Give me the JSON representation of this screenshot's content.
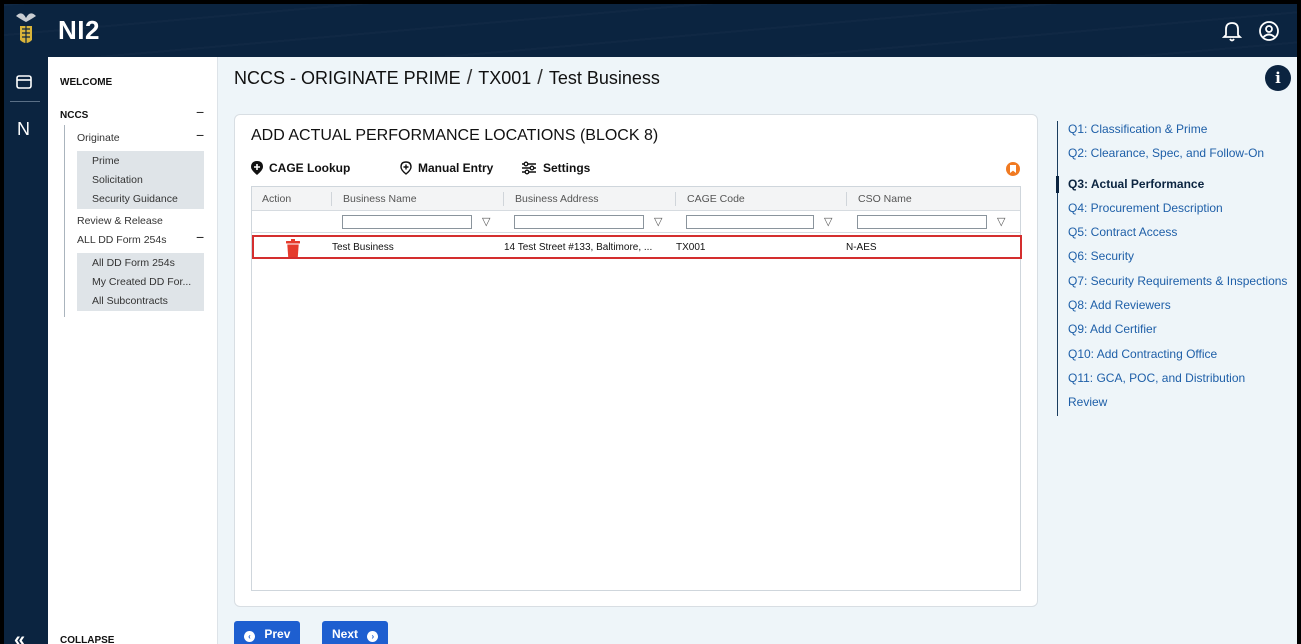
{
  "app": {
    "brand": "NI2"
  },
  "rail": {
    "letter": "N",
    "collapse_glyph": "«"
  },
  "sidenav": {
    "welcome": "WELCOME",
    "nccs": "NCCS",
    "originate": "Originate",
    "originate_items": [
      "Prime",
      "Solicitation",
      "Security Guidance"
    ],
    "review_release": "Review & Release",
    "all_dd": "ALL DD Form 254s",
    "all_dd_items": [
      "All DD Form 254s",
      "My Created DD For...",
      "All Subcontracts"
    ],
    "collapse": "COLLAPSE",
    "minus": "−"
  },
  "breadcrumb": {
    "part1": "NCCS - ORIGINATE PRIME",
    "part2": "TX001",
    "part3": "Test Business",
    "separator": "/"
  },
  "info_glyph": "i",
  "card": {
    "title": "ADD ACTUAL PERFORMANCE LOCATIONS (BLOCK 8)",
    "tools": {
      "cage_lookup": "CAGE Lookup",
      "manual_entry": "Manual Entry",
      "settings": "Settings"
    }
  },
  "grid": {
    "columns": [
      "Action",
      "Business Name",
      "Business Address",
      "CAGE Code",
      "CSO Name"
    ],
    "filter_glyph": "▽",
    "rows": [
      {
        "business_name": "Test Business",
        "business_address": "14 Test Street #133, Baltimore, ...",
        "cage_code": "TX001",
        "cso_name": "N-AES"
      }
    ]
  },
  "steps": [
    "Q1: Classification & Prime",
    "Q2: Clearance, Spec, and Follow-On",
    "Q3: Actual Performance",
    "Q4: Procurement Description",
    "Q5: Contract Access",
    "Q6: Security",
    "Q7: Security Requirements & Inspections",
    "Q8: Add Reviewers",
    "Q9: Add Certifier",
    "Q10: Add Contracting Office",
    "Q11: GCA, POC, and Distribution",
    "Review"
  ],
  "active_step_index": 2,
  "buttons": {
    "prev": "Prev",
    "next": "Next",
    "prev_glyph": "‹",
    "next_glyph": "›"
  },
  "colors": {
    "navy": "#0b2440",
    "accent_blue": "#1e5fd0",
    "highlight_red": "#d42e2e",
    "trash_red": "#e53b2c",
    "bookmark_orange": "#f07a22"
  }
}
